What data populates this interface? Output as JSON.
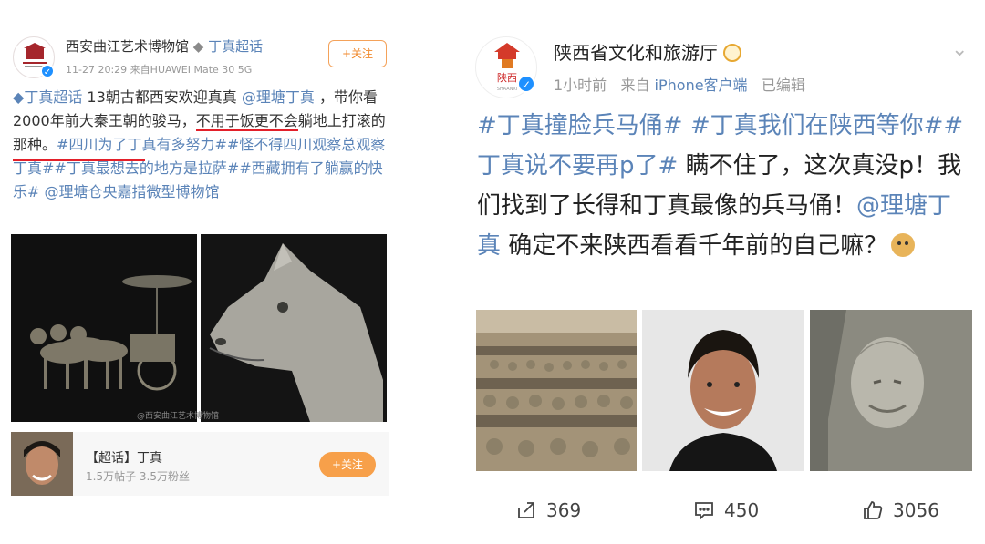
{
  "left_post": {
    "account_name": "西安曲江艺术博物馆",
    "separator": "◆",
    "super_topic": "丁真超话",
    "time": "11-27 20:29",
    "source": "来自HUAWEI Mate 30 5G",
    "follow_label": "+关注",
    "body": {
      "topic_tag": "丁真超话",
      "text1": " 13朝古都西安欢迎真真 ",
      "mention": "@理塘丁真",
      "text2": " ，带你看2000年前大秦王朝的骏马，",
      "underlined1": "不用于饭更不会",
      "underlined2": "躺地上打滚的那种",
      "text3": "。",
      "tags": "#四川为了丁真有多努力##怪不得四川观察总观察丁真##丁真最想去的地方是拉萨##西藏拥有了躺赢的快乐#",
      "mention2": " @理塘仓央嘉措微型博物馆"
    },
    "watermark": "@西安曲江艺术博物馆",
    "card": {
      "title": "【超话】丁真",
      "stats": "1.5万帖子 3.5万粉丝",
      "follow_label": "+关注"
    }
  },
  "right_post": {
    "account_name": "陕西省文化和旅游厅",
    "time": "1小时前",
    "source_prefix": "来自 ",
    "client": "iPhone客户端",
    "edited": "已编辑",
    "body": {
      "tags": "#丁真撞脸兵马俑# #丁真我们在陕西等你##丁真说不要再p了#",
      "text1": " 瞒不住了，这次真没p！我们找到了长得和丁真最像的兵马俑！",
      "mention": "@理塘丁真",
      "text2": " 确定不来陕西看看千年前的自己嘛？"
    },
    "actions": {
      "share_count": "369",
      "comment_count": "450",
      "like_count": "3056"
    }
  },
  "colors": {
    "link_blue": "#5b84b8",
    "follow_orange": "#f08a2e",
    "underline_red": "#e3202a",
    "verified_blue": "#1e90ff"
  },
  "icons": [
    "verified-icon",
    "share-icon",
    "comment-icon",
    "like-icon",
    "chevron-down-icon",
    "doge-emoji-icon"
  ]
}
